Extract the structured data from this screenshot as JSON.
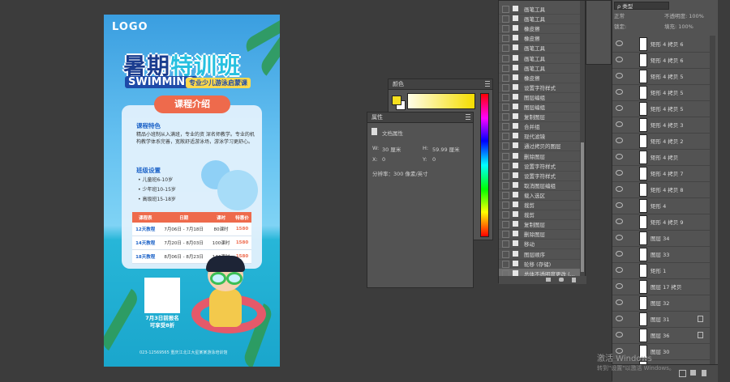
{
  "poster": {
    "logo": "LOGO",
    "title_part1": "暑期",
    "title_part2": "特训班",
    "swimming": "SWIMMING",
    "subtitle": "专业少儿游泳启蒙课",
    "section_tag": "课程介绍",
    "features_title": "课程特色",
    "features_text": "精品小班制从入满班，专业的资 深名师教学。专业的机构教学体系完善，宽敞舒适游泳场，游泳学习更舒心。",
    "classes_title": "班级设置",
    "classes": [
      "• 儿童班6-10岁",
      "• 少年班10-15岁",
      "• 高级班15-18岁"
    ],
    "table_headers": [
      "课程表",
      "日期",
      "课时",
      "特惠价"
    ],
    "table_rows": [
      [
        "12天教程",
        "7月06日 - 7月18日",
        "80课时",
        "1580"
      ],
      [
        "14天教程",
        "7月20日 - 8月03日",
        "100课时",
        "1580"
      ],
      [
        "18天教程",
        "8月06日 - 8月23日",
        "144课时",
        "1580"
      ]
    ],
    "early_line1": "7月3日前报名",
    "early_line2": "可享受8折",
    "footer": "023-12569565    重庆江北江大星某某游泳培训馆"
  },
  "color_panel": {
    "title": "颜色",
    "fg": "#f8e01e",
    "bg": "#ffffff"
  },
  "properties": {
    "title": "属性",
    "doc_label": "文档属性",
    "w_label": "W:",
    "w_value": "30 厘米",
    "h_label": "H:",
    "h_value": "59.99 厘米",
    "x_label": "X:",
    "x_value": "0",
    "y_label": "Y:",
    "y_value": "0",
    "resolution": "分辨率：300 像素/英寸"
  },
  "history": {
    "items": [
      "画笔工具",
      "画笔工具",
      "橡皮擦",
      "橡皮擦",
      "画笔工具",
      "画笔工具",
      "画笔工具",
      "橡皮擦",
      "设置字符样式",
      "图层编组",
      "图层编组",
      "复制图层",
      "合并组",
      "现代滤镜",
      "通过拷贝的图层",
      "删除图层",
      "设置字符样式",
      "设置字符样式",
      "取消图层编组",
      "载入选区",
      "裁剪",
      "裁剪",
      "复制图层",
      "删除图层",
      "移动",
      "图层顺序",
      "轮移 (存储)",
      "总体不透明度更改 (..."
    ],
    "selected_index": 27
  },
  "layers": {
    "search": "ρ 类型",
    "mode": "正常",
    "opacity": "不透明度: 100%",
    "lock": "锁定:",
    "fill": "填充: 100%",
    "items": [
      {
        "name": "矩形 4 拷贝 6",
        "lock": false
      },
      {
        "name": "矩形 4 拷贝 6",
        "lock": false
      },
      {
        "name": "矩形 4 拷贝 5",
        "lock": false
      },
      {
        "name": "矩形 4 拷贝 5",
        "lock": false
      },
      {
        "name": "矩形 4 拷贝 5",
        "lock": false
      },
      {
        "name": "矩形 4 拷贝 3",
        "lock": false
      },
      {
        "name": "矩形 4 拷贝 2",
        "lock": false
      },
      {
        "name": "矩形 4 拷贝",
        "lock": false
      },
      {
        "name": "矩形 4 拷贝 7",
        "lock": false
      },
      {
        "name": "矩形 4 拷贝 8",
        "lock": false
      },
      {
        "name": "矩形 4",
        "lock": false
      },
      {
        "name": "矩形 4 拷贝 9",
        "lock": false
      },
      {
        "name": "图层 34",
        "lock": false
      },
      {
        "name": "图层 33",
        "lock": false
      },
      {
        "name": "矩形 1",
        "lock": false
      },
      {
        "name": "图层 17 拷贝",
        "lock": false
      },
      {
        "name": "图层 32",
        "lock": false
      },
      {
        "name": "图层 31",
        "lock": true
      },
      {
        "name": "图层 36",
        "lock": true
      },
      {
        "name": "图层 30",
        "lock": false
      },
      {
        "name": "图层 29",
        "lock": false
      }
    ]
  },
  "watermark": {
    "line1": "激活 Windows",
    "line2": "转到\"设置\"以激活 Windows。"
  }
}
